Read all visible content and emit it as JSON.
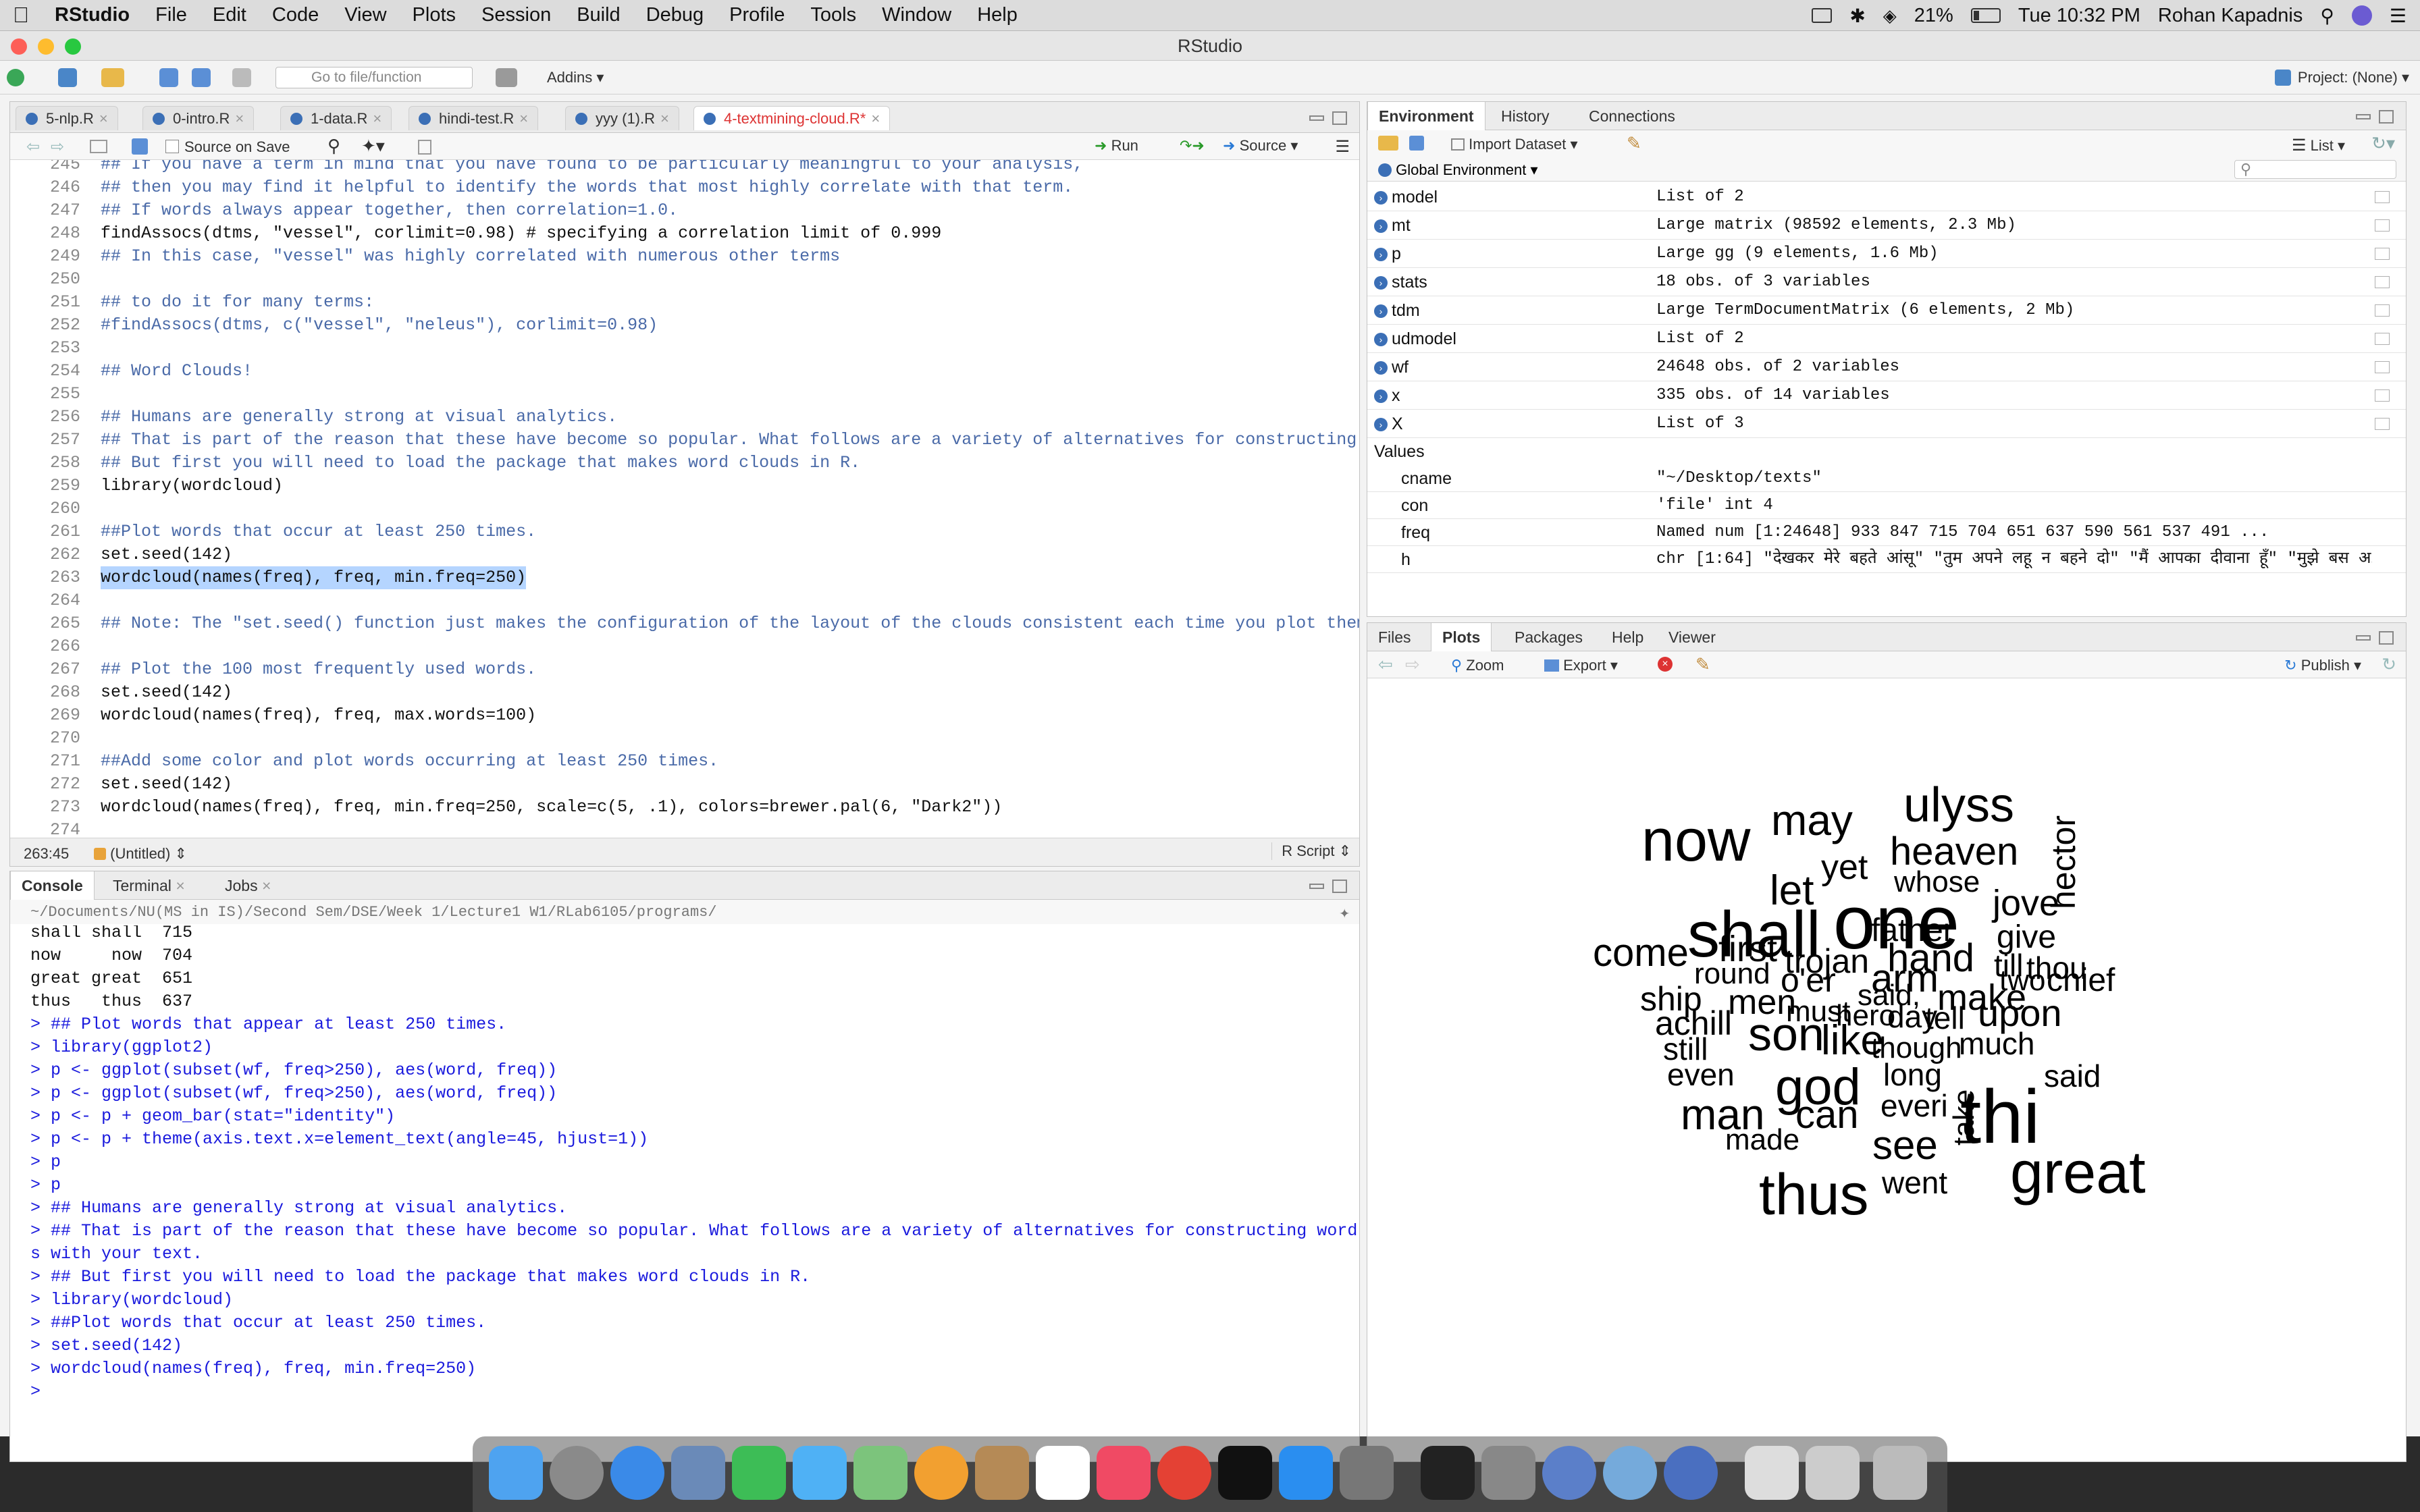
{
  "menubar": {
    "app": "RStudio",
    "items": [
      "File",
      "Edit",
      "Code",
      "View",
      "Plots",
      "Session",
      "Build",
      "Debug",
      "Profile",
      "Tools",
      "Window",
      "Help"
    ],
    "battery": "21%",
    "datetime": "Tue 10:32 PM",
    "user": "Rohan Kapadnis"
  },
  "window": {
    "title": "RStudio",
    "goto_placeholder": "Go to file/function",
    "addins_label": "Addins",
    "project_label": "Project: (None)"
  },
  "editor": {
    "tabs": [
      "5-nlp.R",
      "0-intro.R",
      "1-data.R",
      "hindi-test.R",
      "yyy (1).R",
      "4-textmining-cloud.R*"
    ],
    "source_on_save": "Source on Save",
    "run_label": "Run",
    "source_label": "Source",
    "lines": [
      {
        "n": "245",
        "t": "## If you have a term in mind that you have found to be particularly meaningful to your analysis,",
        "k": "cm"
      },
      {
        "n": "246",
        "t": "## then you may find it helpful to identify the words that most highly correlate with that term.",
        "k": "cm"
      },
      {
        "n": "247",
        "t": "## If words always appear together, then correlation=1.0.",
        "k": "cm"
      },
      {
        "n": "248",
        "t": "findAssocs(dtms, \"vessel\", corlimit=0.98) # specifying a correlation limit of 0.999",
        "k": "code"
      },
      {
        "n": "249",
        "t": "## In this case, \"vessel\" was highly correlated with numerous other terms",
        "k": "cm"
      },
      {
        "n": "250",
        "t": "",
        "k": "code"
      },
      {
        "n": "251",
        "t": "## to do it for many terms:",
        "k": "cm"
      },
      {
        "n": "252",
        "t": "#findAssocs(dtms, c(\"vessel\", \"neleus\"), corlimit=0.98)",
        "k": "cm"
      },
      {
        "n": "253",
        "t": "",
        "k": "code"
      },
      {
        "n": "254",
        "t": "## Word Clouds!",
        "k": "cm"
      },
      {
        "n": "255",
        "t": "",
        "k": "code"
      },
      {
        "n": "256",
        "t": "## Humans are generally strong at visual analytics.",
        "k": "cm"
      },
      {
        "n": "257",
        "t": "## That is part of the reason that these have become so popular. What follows are a variety of alternatives for constructing word",
        "k": "cm"
      },
      {
        "n": "258",
        "t": "## But first you will need to load the package that makes word clouds in R.",
        "k": "cm"
      },
      {
        "n": "259",
        "t": "library(wordcloud)",
        "k": "code"
      },
      {
        "n": "260",
        "t": "",
        "k": "code"
      },
      {
        "n": "261",
        "t": "##Plot words that occur at least 250 times.",
        "k": "cm"
      },
      {
        "n": "262",
        "t": "set.seed(142)",
        "k": "code"
      },
      {
        "n": "263",
        "t": "wordcloud(names(freq), freq, min.freq=250)",
        "k": "sel"
      },
      {
        "n": "264",
        "t": "",
        "k": "code"
      },
      {
        "n": "265",
        "t": "## Note: The \"set.seed() function just makes the configuration of the layout of the clouds consistent each time you plot them. You",
        "k": "cm"
      },
      {
        "n": "266",
        "t": "",
        "k": "code"
      },
      {
        "n": "267",
        "t": "## Plot the 100 most frequently used words.",
        "k": "cm"
      },
      {
        "n": "268",
        "t": "set.seed(142)",
        "k": "code"
      },
      {
        "n": "269",
        "t": "wordcloud(names(freq), freq, max.words=100)",
        "k": "code"
      },
      {
        "n": "270",
        "t": "",
        "k": "code"
      },
      {
        "n": "271",
        "t": "##Add some color and plot words occurring at least 250 times.",
        "k": "cm"
      },
      {
        "n": "272",
        "t": "set.seed(142)",
        "k": "code"
      },
      {
        "n": "273",
        "t": "wordcloud(names(freq), freq, min.freq=250, scale=c(5, .1), colors=brewer.pal(6, \"Dark2\"))",
        "k": "code"
      },
      {
        "n": "274",
        "t": "",
        "k": "code"
      }
    ],
    "status_pos": "263:45",
    "status_scope": "(Untitled)",
    "status_type": "R Script"
  },
  "console": {
    "tabs": [
      "Console",
      "Terminal",
      "Jobs"
    ],
    "path": "~/Documents/NU(MS in IS)/Second Sem/DSE/Week 1/Lecture1 W1/RLab6105/programs/",
    "lines": [
      {
        "t": "shall shall  715",
        "k": "out"
      },
      {
        "t": "now     now  704",
        "k": "out"
      },
      {
        "t": "great great  651",
        "k": "out"
      },
      {
        "t": "thus   thus  637",
        "k": "out"
      },
      {
        "t": "> ## Plot words that appear at least 250 times.",
        "k": "in"
      },
      {
        "t": "> library(ggplot2)",
        "k": "in"
      },
      {
        "t": "> p <- ggplot(subset(wf, freq>250), aes(word, freq))",
        "k": "in"
      },
      {
        "t": "> p <- ggplot(subset(wf, freq>250), aes(word, freq))",
        "k": "in"
      },
      {
        "t": "> p <- p + geom_bar(stat=\"identity\")",
        "k": "in"
      },
      {
        "t": "> p <- p + theme(axis.text.x=element_text(angle=45, hjust=1))",
        "k": "in"
      },
      {
        "t": "> p",
        "k": "in"
      },
      {
        "t": "> p",
        "k": "in"
      },
      {
        "t": "> ## Humans are generally strong at visual analytics.",
        "k": "in"
      },
      {
        "t": "> ## That is part of the reason that these have become so popular. What follows are a variety of alternatives for constructing word cloud",
        "k": "in"
      },
      {
        "t": "s with your text.",
        "k": "in"
      },
      {
        "t": "> ## But first you will need to load the package that makes word clouds in R.",
        "k": "in"
      },
      {
        "t": "> library(wordcloud)",
        "k": "in"
      },
      {
        "t": "> ##Plot words that occur at least 250 times.",
        "k": "in"
      },
      {
        "t": "> set.seed(142)",
        "k": "in"
      },
      {
        "t": "> wordcloud(names(freq), freq, min.freq=250)",
        "k": "in"
      },
      {
        "t": "> ",
        "k": "in"
      }
    ]
  },
  "environment": {
    "tabs": [
      "Environment",
      "History",
      "Connections"
    ],
    "import_label": "Import Dataset",
    "list_label": "List",
    "scope_label": "Global Environment",
    "data": [
      {
        "name": "model",
        "value": "List of 2"
      },
      {
        "name": "mt",
        "value": "Large matrix (98592 elements, 2.3 Mb)"
      },
      {
        "name": "p",
        "value": "Large gg (9 elements, 1.6 Mb)"
      },
      {
        "name": "stats",
        "value": "18 obs. of 3 variables"
      },
      {
        "name": "tdm",
        "value": "Large TermDocumentMatrix (6 elements, 2 Mb)"
      },
      {
        "name": "udmodel",
        "value": "List of 2"
      },
      {
        "name": "wf",
        "value": "24648 obs. of 2 variables"
      },
      {
        "name": "x",
        "value": "335 obs. of 14 variables"
      },
      {
        "name": "X",
        "value": "List of 3"
      }
    ],
    "values_header": "Values",
    "values": [
      {
        "name": "cname",
        "value": "\"~/Desktop/texts\""
      },
      {
        "name": "con",
        "value": "'file' int 4"
      },
      {
        "name": "freq",
        "value": "Named num [1:24648] 933 847 715 704 651 637 590 561 537 491 ..."
      },
      {
        "name": "h",
        "value": "chr [1:64] \"देखकर मेरे बहते आंसू\" \"तुम अपने लहू न बहने दो\" \"मैं आपका दीवाना हूँ\" \"मुझे बस अ…"
      }
    ]
  },
  "files_pane": {
    "tabs": [
      "Files",
      "Plots",
      "Packages",
      "Help",
      "Viewer"
    ],
    "zoom_label": "Zoom",
    "export_label": "Export",
    "publish_label": "Publish"
  },
  "chart_data": {
    "type": "wordcloud",
    "words": [
      {
        "text": "ulyss",
        "size": 72,
        "rot": 0
      },
      {
        "text": "may",
        "size": 64,
        "rot": 0
      },
      {
        "text": "now",
        "size": 88,
        "rot": 0
      },
      {
        "text": "heaven",
        "size": 58,
        "rot": 0
      },
      {
        "text": "yet",
        "size": 52,
        "rot": 0
      },
      {
        "text": "let",
        "size": 62,
        "rot": 0
      },
      {
        "text": "whose",
        "size": 44,
        "rot": 0
      },
      {
        "text": "one",
        "size": 112,
        "rot": 0
      },
      {
        "text": "shall",
        "size": 96,
        "rot": 0
      },
      {
        "text": "jove",
        "size": 54,
        "rot": 0
      },
      {
        "text": "hector",
        "size": 50,
        "rot": -90
      },
      {
        "text": "father",
        "size": 48,
        "rot": 0
      },
      {
        "text": "give",
        "size": 48,
        "rot": 0
      },
      {
        "text": "come",
        "size": 58,
        "rot": 0
      },
      {
        "text": "first",
        "size": 54,
        "rot": 0
      },
      {
        "text": "trojan",
        "size": 50,
        "rot": 0
      },
      {
        "text": "hand",
        "size": 58,
        "rot": 0
      },
      {
        "text": "till",
        "size": 46,
        "rot": 0
      },
      {
        "text": "thou",
        "size": 46,
        "rot": 0
      },
      {
        "text": "round",
        "size": 44,
        "rot": 0
      },
      {
        "text": "two",
        "size": 44,
        "rot": 0
      },
      {
        "text": "chief",
        "size": 48,
        "rot": 0
      },
      {
        "text": "o'er",
        "size": 50,
        "rot": 0
      },
      {
        "text": "arm",
        "size": 58,
        "rot": 0
      },
      {
        "text": "ship",
        "size": 50,
        "rot": 0
      },
      {
        "text": "men",
        "size": 52,
        "rot": 0
      },
      {
        "text": "said,",
        "size": 44,
        "rot": 0
      },
      {
        "text": "make",
        "size": 54,
        "rot": 0
      },
      {
        "text": "must",
        "size": 44,
        "rot": 0
      },
      {
        "text": "hero",
        "size": 44,
        "rot": 0
      },
      {
        "text": "day",
        "size": 46,
        "rot": 0
      },
      {
        "text": "tell",
        "size": 46,
        "rot": 0
      },
      {
        "text": "upon",
        "size": 56,
        "rot": 0
      },
      {
        "text": "achill",
        "size": 50,
        "rot": 0
      },
      {
        "text": "son",
        "size": 70,
        "rot": 0
      },
      {
        "text": "like",
        "size": 62,
        "rot": 0
      },
      {
        "text": "still",
        "size": 46,
        "rot": 0
      },
      {
        "text": "though",
        "size": 44,
        "rot": 0
      },
      {
        "text": "much",
        "size": 46,
        "rot": 0
      },
      {
        "text": "even",
        "size": 46,
        "rot": 0
      },
      {
        "text": "god",
        "size": 76,
        "rot": 0
      },
      {
        "text": "long",
        "size": 46,
        "rot": 0
      },
      {
        "text": "thi",
        "size": 112,
        "rot": 0
      },
      {
        "text": "said",
        "size": 46,
        "rot": 0
      },
      {
        "text": "man",
        "size": 64,
        "rot": 0
      },
      {
        "text": "can",
        "size": 58,
        "rot": 0
      },
      {
        "text": "everi",
        "size": 46,
        "rot": 0
      },
      {
        "text": "made",
        "size": 44,
        "rot": 0
      },
      {
        "text": "see",
        "size": 60,
        "rot": 0
      },
      {
        "text": "take",
        "size": 44,
        "rot": -90
      },
      {
        "text": "great",
        "size": 88,
        "rot": 0
      },
      {
        "text": "thus",
        "size": 86,
        "rot": 0
      },
      {
        "text": "went",
        "size": 46,
        "rot": 0
      }
    ]
  }
}
